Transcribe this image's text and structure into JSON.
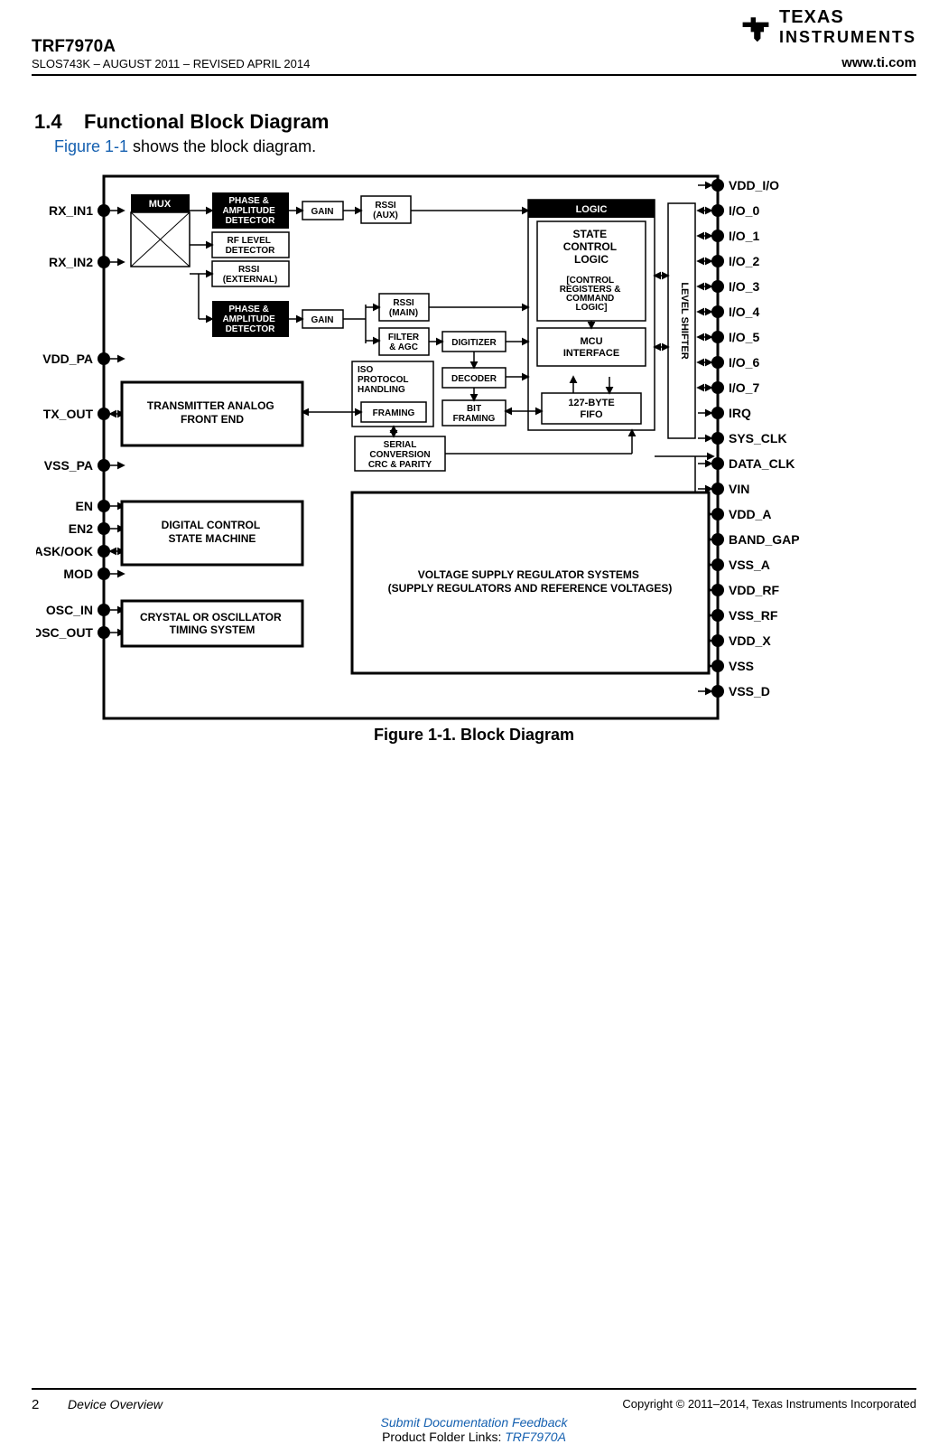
{
  "header": {
    "chip": "TRF7970A",
    "docline": "SLOS743K – AUGUST 2011 – REVISED APRIL 2014",
    "logo_top": "TEXAS",
    "logo_bottom": "INSTRUMENTS",
    "url": "www.ti.com"
  },
  "section": {
    "number": "1.4",
    "title": "Functional Block Diagram"
  },
  "intro": {
    "figref": "Figure 1-1",
    "after": " shows the block diagram."
  },
  "caption": "Figure 1-1. Block Diagram",
  "blocks": {
    "mux": "MUX",
    "phaseamp": "PHASE &\nAMPLITUDE\nDETECTOR",
    "phaseamp2": "PHASE &\nAMPLITUDE\nDETECTOR",
    "rflevel": "RF LEVEL\nDETECTOR",
    "rssiext": "RSSI\n(EXTERNAL)",
    "gain1": "GAIN",
    "gain2": "GAIN",
    "rssiaux": "RSSI\n(AUX)",
    "rssimain": "RSSI\n(MAIN)",
    "filteragc": "FILTER\n& AGC",
    "digitizer": "DIGITIZER",
    "decoder": "DECODER",
    "isoproto": "ISO\nPROTOCOL\nHANDLING",
    "framing": "FRAMING",
    "bitframing": "BIT\nFRAMING",
    "serialconv": "SERIAL\nCONVERSION\nCRC & PARITY",
    "logic": "LOGIC",
    "statectrl_top": "STATE\nCONTROL\nLOGIC",
    "statectrl_sub": "[CONTROL\nREGISTERS &\nCOMMAND\nLOGIC]",
    "mcuifc": "MCU\nINTERFACE",
    "fifo": "127-BYTE\nFIFO",
    "levelshifter": "LEVEL SHIFTER",
    "txafe": "TRANSMITTER ANALOG\nFRONT END",
    "digctrl": "DIGITAL CONTROL\nSTATE MACHINE",
    "osc": "CRYSTAL OR OSCILLATOR\nTIMING SYSTEM",
    "vreg": "VOLTAGE SUPPLY REGULATOR SYSTEMS\n(SUPPLY REGULATORS AND REFERENCE VOLTAGES)"
  },
  "pins_left": [
    "RX_IN1",
    "RX_IN2",
    "VDD_PA",
    "TX_OUT",
    "VSS_PA",
    "EN",
    "EN2",
    "ASK/OOK",
    "MOD",
    "OSC_IN",
    "OSC_OUT"
  ],
  "pins_right": [
    "VDD_I/O",
    "I/O_0",
    "I/O_1",
    "I/O_2",
    "I/O_3",
    "I/O_4",
    "I/O_5",
    "I/O_6",
    "I/O_7",
    "IRQ",
    "SYS_CLK",
    "DATA_CLK",
    "VIN",
    "VDD_A",
    "BAND_GAP",
    "VSS_A",
    "VDD_RF",
    "VSS_RF",
    "VDD_X",
    "VSS",
    "VSS_D"
  ],
  "footer": {
    "pagenum": "2",
    "section": "Device Overview",
    "copyright": "Copyright © 2011–2014, Texas Instruments Incorporated",
    "feedback_link": "Submit Documentation Feedback",
    "folder_prefix": "Product Folder Links: ",
    "folder_link": "TRF7970A"
  }
}
